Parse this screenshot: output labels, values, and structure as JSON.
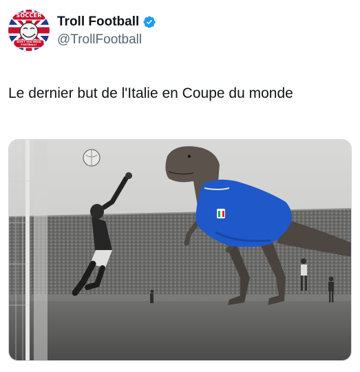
{
  "tweet": {
    "author": {
      "display_name": "Troll Football",
      "handle": "@TrollFootball",
      "verified": true,
      "avatar_text_top": "SOCCER",
      "avatar_text_bottom": "DON'T YOU MEAN FOOTBALL?"
    },
    "text": "Le dernier but de l'Italie en Coupe du monde",
    "media": {
      "kind": "photo",
      "icons": [
        "goalkeeper-figure",
        "dinosaur-figure",
        "football-icon"
      ]
    },
    "colors": {
      "verified_blue": "#1d9bf0",
      "handle_gray": "#536471",
      "italy_blue": "#1f58c9"
    }
  }
}
